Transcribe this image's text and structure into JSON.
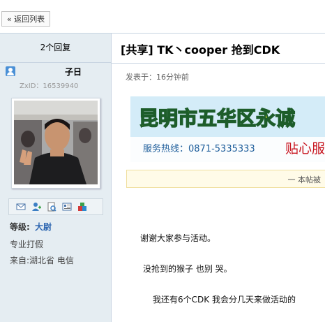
{
  "nav": {
    "back_label": "« 返回列表"
  },
  "sidebar": {
    "reply_count": "2个回复",
    "username": "子日",
    "zxid": "ZxID：16539940",
    "rank_label": "等级:",
    "rank_value": "大尉",
    "user_title": "专业打假",
    "location": "来自:湖北省  电信",
    "tool_icons": [
      "message-icon",
      "add-friend-icon",
      "profile-icon",
      "card-icon",
      "gift-icon"
    ]
  },
  "post": {
    "title": "[共享] TK丶cooper  抢到CDK",
    "time": "发表于：16分钟前",
    "banner": {
      "headline": "昆明市五华区永诚",
      "hotline": "服务热线：0871-5335333",
      "slogan": "贴心服"
    },
    "notice": "一  本帖被",
    "lines": [
      "谢谢大家参与活动。",
      "没抢到的猴子 也别 哭。",
      "我还有6个CDK 我会分几天来做活动的"
    ]
  },
  "colors": {
    "sidebar_bg": "#e5edf2",
    "rank": "#2e67b1",
    "banner_red": "#c8141e",
    "banner_blue": "#1c5c9a"
  }
}
